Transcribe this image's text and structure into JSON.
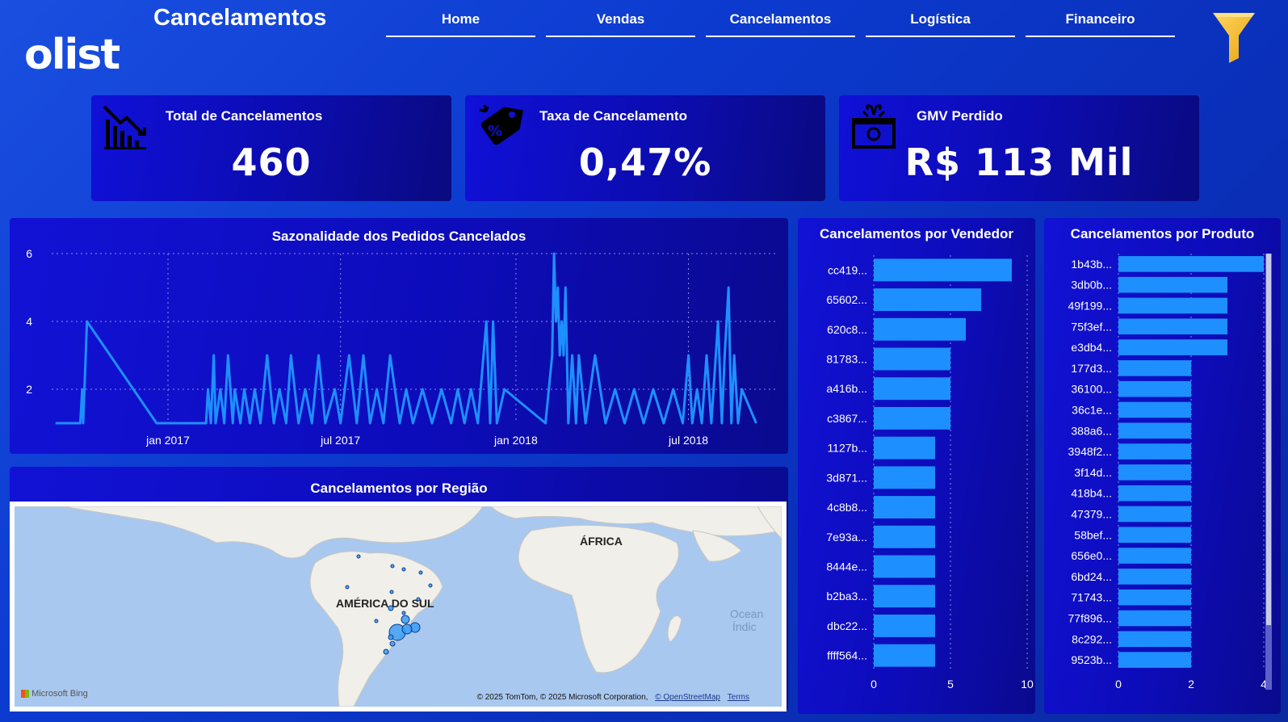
{
  "header": {
    "logo_text": "olist",
    "page_title": "Cancelamentos",
    "nav": [
      "Home",
      "Vendas",
      "Cancelamentos",
      "Logística",
      "Financeiro"
    ],
    "active_nav": "Cancelamentos",
    "filter_icon": "funnel-icon",
    "accent_filter_color": "#f5c23c"
  },
  "kpis": [
    {
      "label": "Total de Cancelamentos",
      "value": "460",
      "icon": "declining-chart-icon"
    },
    {
      "label": "Taxa de Cancelamento",
      "value": "0,47%",
      "icon": "discount-tag-icon"
    },
    {
      "label": "GMV Perdido",
      "value": "R$ 113 Mil",
      "icon": "broken-gift-icon"
    }
  ],
  "seasonality": {
    "title": "Sazonalidade dos Pedidos Cancelados",
    "chart_data": {
      "type": "line",
      "x_tick_labels": [
        "jan 2017",
        "jul 2017",
        "jan 2018",
        "jul 2018"
      ],
      "y_ticks": [
        2,
        4,
        6
      ],
      "ylim": [
        1,
        6
      ],
      "xlim": [
        "2016-09-01",
        "2018-09-30"
      ],
      "color": "#1e8fff",
      "grid": true,
      "series": [
        {
          "x": [
            "2016-09-05",
            "2016-10-01",
            "2016-10-03",
            "2016-10-04",
            "2016-10-08",
            "2016-12-20",
            "2017-02-10",
            "2017-02-12",
            "2017-02-15",
            "2017-02-18",
            "2017-02-20",
            "2017-02-25",
            "2017-03-01",
            "2017-03-05",
            "2017-03-10",
            "2017-03-12",
            "2017-03-18",
            "2017-03-22",
            "2017-03-28",
            "2017-04-02",
            "2017-04-08",
            "2017-04-15",
            "2017-04-22",
            "2017-04-28",
            "2017-05-05",
            "2017-05-10",
            "2017-05-18",
            "2017-05-25",
            "2017-06-01",
            "2017-06-08",
            "2017-06-15",
            "2017-06-25",
            "2017-07-01",
            "2017-07-10",
            "2017-07-18",
            "2017-07-25",
            "2017-08-01",
            "2017-08-08",
            "2017-08-15",
            "2017-08-22",
            "2017-09-01",
            "2017-09-08",
            "2017-09-15",
            "2017-09-25",
            "2017-10-05",
            "2017-10-15",
            "2017-10-25",
            "2017-11-01",
            "2017-11-08",
            "2017-11-15",
            "2017-11-22",
            "2017-12-01",
            "2017-12-05",
            "2017-12-08",
            "2017-12-12",
            "2017-12-20",
            "2018-02-01",
            "2018-02-08",
            "2018-02-10",
            "2018-02-12",
            "2018-02-14",
            "2018-02-16",
            "2018-02-18",
            "2018-02-20",
            "2018-02-22",
            "2018-02-25",
            "2018-03-01",
            "2018-03-05",
            "2018-03-08",
            "2018-03-15",
            "2018-03-25",
            "2018-04-05",
            "2018-04-15",
            "2018-04-25",
            "2018-05-05",
            "2018-05-15",
            "2018-05-25",
            "2018-06-05",
            "2018-06-15",
            "2018-06-25",
            "2018-07-01",
            "2018-07-05",
            "2018-07-10",
            "2018-07-15",
            "2018-07-20",
            "2018-07-25",
            "2018-08-01",
            "2018-08-05",
            "2018-08-08",
            "2018-08-12",
            "2018-08-15",
            "2018-08-18",
            "2018-08-22",
            "2018-08-26",
            "2018-09-10"
          ],
          "y": [
            1,
            1,
            2,
            1,
            4,
            1,
            1,
            2,
            1,
            3,
            1,
            2,
            1,
            3,
            1,
            2,
            1,
            2,
            1,
            2,
            1,
            3,
            1,
            2,
            1,
            3,
            1,
            2,
            1,
            3,
            1,
            2,
            1,
            3,
            1,
            3,
            1,
            2,
            1,
            3,
            1,
            2,
            1,
            2,
            1,
            2,
            1,
            2,
            1,
            2,
            1,
            4,
            1,
            4,
            1,
            2,
            1,
            3,
            6,
            4,
            5,
            3,
            4,
            3,
            5,
            1,
            3,
            1,
            3,
            1,
            3,
            1,
            2,
            1,
            2,
            1,
            2,
            1,
            2,
            1,
            3,
            1,
            2,
            1,
            3,
            1,
            4,
            1,
            3,
            5,
            1,
            3,
            1,
            2,
            1
          ]
        }
      ]
    }
  },
  "by_seller": {
    "title": "Cancelamentos por Vendedor",
    "chart_data": {
      "type": "bar",
      "orientation": "horizontal",
      "categories": [
        "cc419...",
        "65602...",
        "620c8...",
        "81783...",
        "a416b...",
        "c3867...",
        "1127b...",
        "3d871...",
        "4c8b8...",
        "7e93a...",
        "8444e...",
        "b2ba3...",
        "dbc22...",
        "ffff564..."
      ],
      "values": [
        9,
        7,
        6,
        5,
        5,
        5,
        4,
        4,
        4,
        4,
        4,
        4,
        4,
        4
      ],
      "x_ticks": [
        0,
        5,
        10
      ],
      "xlim": [
        0,
        10
      ],
      "color": "#1e8fff"
    }
  },
  "by_product": {
    "title": "Cancelamentos por Produto",
    "chart_data": {
      "type": "bar",
      "orientation": "horizontal",
      "categories": [
        "1b43b...",
        "3db0b...",
        "49f199...",
        "75f3ef...",
        "e3db4...",
        "177d3...",
        "36100...",
        "36c1e...",
        "388a6...",
        "3948f2...",
        "3f14d...",
        "418b4...",
        "47379...",
        "58bef...",
        "656e0...",
        "6bd24...",
        "71743...",
        "77f896...",
        "8c292...",
        "9523b..."
      ],
      "values": [
        4,
        3,
        3,
        3,
        3,
        2,
        2,
        2,
        2,
        2,
        2,
        2,
        2,
        2,
        2,
        2,
        2,
        2,
        2,
        2
      ],
      "x_ticks": [
        0,
        2,
        4
      ],
      "xlim": [
        0,
        4
      ],
      "color": "#1e8fff"
    }
  },
  "map": {
    "title": "Cancelamentos por Região",
    "labels": {
      "south_america": "AMÉRICA DO SUL",
      "africa": "ÁFRICA",
      "ocean_a": "Ocean",
      "ocean_b": "Índic"
    },
    "bing_logo": "Microsoft Bing",
    "attribution": "© 2025 TomTom, © 2025 Microsoft Corporation,",
    "osm_link": "© OpenStreetMap",
    "terms_link": "Terms",
    "bubble_color": "#3a9cf5"
  }
}
